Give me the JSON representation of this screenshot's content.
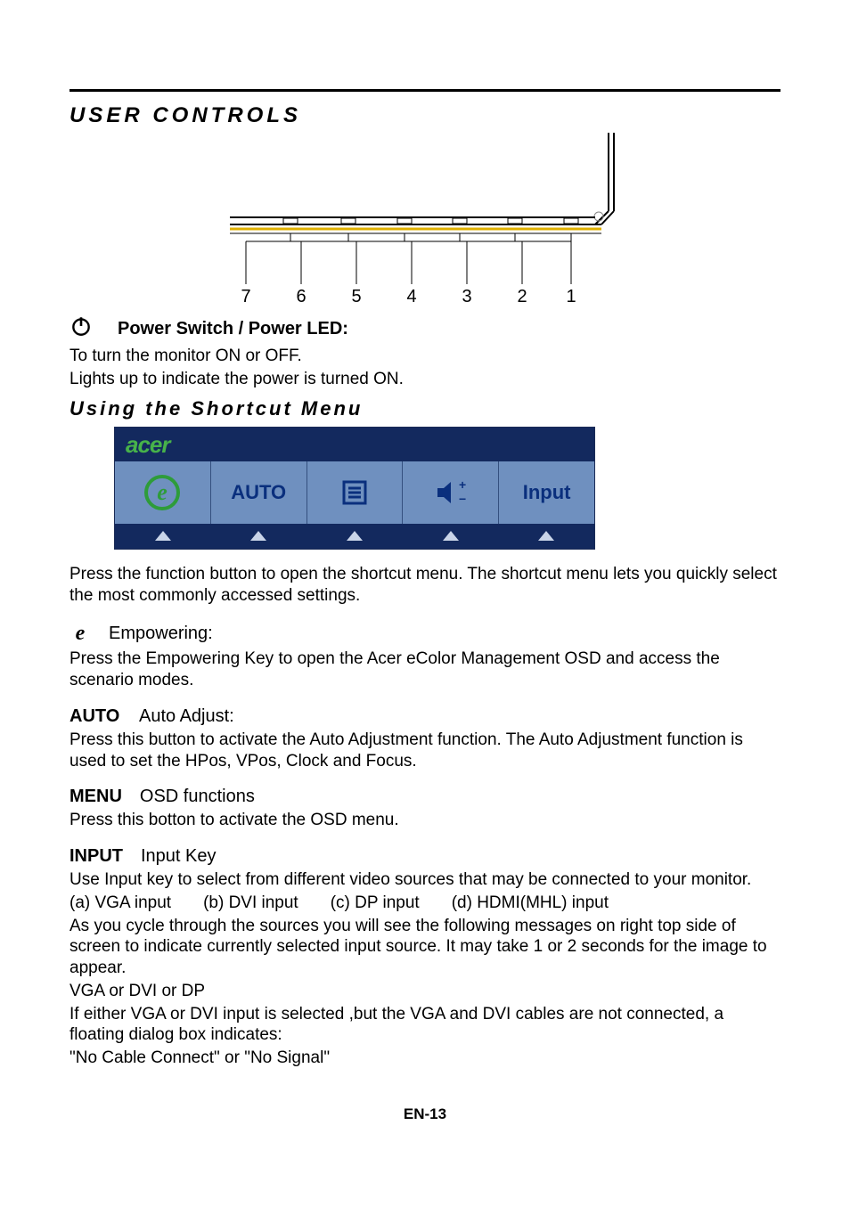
{
  "title": "USER CONTROLS",
  "diagram_numbers": [
    "7",
    "6",
    "5",
    "4",
    "3",
    "2",
    "1"
  ],
  "power": {
    "heading": "Power Switch / Power LED:",
    "line1": "To turn the monitor ON or OFF.",
    "line2": "Lights up to indicate the power is turned ON."
  },
  "subheading": "Using  the  Shortcut  Menu",
  "menu": {
    "logo": "acer",
    "items": [
      "e",
      "AUTO",
      "menu-icon",
      "volume-icon",
      "Input"
    ]
  },
  "shortcut_desc": "Press the function button to open the shortcut menu. The shortcut menu lets you quickly select the most commonly accessed settings.",
  "empowering": {
    "tag": "e",
    "name": "Empowering:",
    "desc": "Press the Empowering Key to open the Acer eColor Management OSD and access the scenario modes."
  },
  "auto": {
    "tag": "AUTO",
    "name": "Auto Adjust:",
    "desc": "Press this button to activate the Auto Adjustment function. The Auto Adjustment function is used to set the HPos, VPos, Clock and Focus."
  },
  "menu_section": {
    "tag": "MENU",
    "name": "OSD functions",
    "desc": "Press this botton to activate the OSD menu."
  },
  "input": {
    "tag": "INPUT",
    "name": "Input Key",
    "desc1": "Use Input key to select from different video sources that may be connected to your monitor.",
    "list": {
      "a": "(a) VGA input",
      "b": "(b) DVI input",
      "c": "(c) DP input",
      "d": "(d) HDMI(MHL) input"
    },
    "desc2": "As you cycle through the sources you will see the following messages on right top side of screen to indicate currently selected input source. It may take 1 or 2 seconds for the image to appear.",
    "line_vga": "VGA  or  DVI  or  DP",
    "desc3": "If either VGA or DVI input is selected ,but the VGA and DVI cables are not connected, a floating dialog box indicates:",
    "desc4": "\"No Cable Connect\" or \"No Signal\""
  },
  "footer": "EN-13"
}
